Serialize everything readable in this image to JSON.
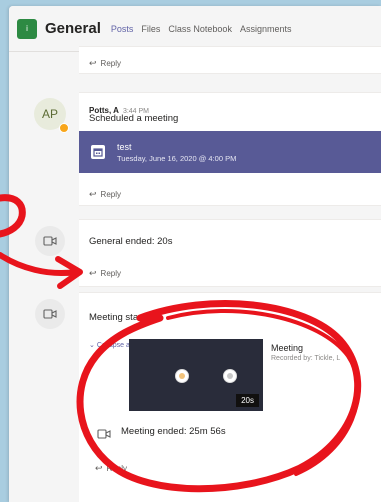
{
  "header": {
    "team_initial": "i",
    "channel": "General",
    "tabs": [
      "Posts",
      "Files",
      "Class Notebook",
      "Assignments"
    ],
    "active_tab": "Posts"
  },
  "thread": {
    "reply_label": "Reply",
    "post": {
      "avatar_initials": "AP",
      "author": "Potts, A",
      "time": "3:44 PM",
      "message": "Scheduled a meeting",
      "meeting": {
        "title": "test",
        "datetime": "Tuesday, June 16, 2020 @ 4:00 PM"
      }
    },
    "general_ended": "General ended: 20s",
    "meeting_started": "Meeting started",
    "collapse_all": "Collapse all",
    "recording": {
      "title": "Meeting",
      "recorded_by": "Recorded by: Tickle, L",
      "duration": "20s"
    },
    "meeting_ended": "Meeting ended: 25m 56s"
  },
  "annotation": {
    "color": "#e8141c"
  },
  "colors": {
    "accent": "#6264a7",
    "banner": "#585a96",
    "team_tile": "#2d8a43"
  }
}
